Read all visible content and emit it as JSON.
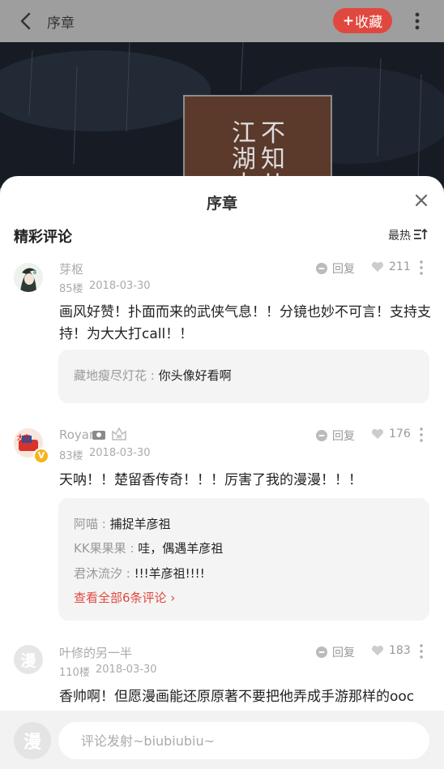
{
  "header": {
    "title": "序章",
    "favorite_label": "收藏",
    "favorite_plus": "+"
  },
  "cover": {
    "chars_col1": [
      "江",
      "湖",
      "中"
    ],
    "chars_col2": [
      "不",
      "知",
      "从"
    ]
  },
  "sheet": {
    "title": "序章",
    "section_title": "精彩评论",
    "sort_label": "最热"
  },
  "comments": [
    {
      "user": "芽枢",
      "floor": "85楼",
      "date": "2018-03-30",
      "reply_label": "回复",
      "likes": "211",
      "text": "画风好赞！扑面而来的武侠气息！！分镜也妙不可言！支持支持！为大大打call！！",
      "replies": [
        {
          "name": "藏地瘦尽灯花",
          "sep": " : ",
          "text": "你头像好看啊"
        }
      ]
    },
    {
      "user": "Royan",
      "floor": "83楼",
      "date": "2018-03-30",
      "reply_label": "回复",
      "likes": "176",
      "badge": "V",
      "text": "天呐！！楚留香传奇！！！厉害了我的漫漫！！！",
      "replies": [
        {
          "name": "阿喵",
          "sep": " : ",
          "text": "捕捉羊彦祖"
        },
        {
          "name": "KK果果果",
          "sep": " : ",
          "text": "哇，偶遇羊彦祖"
        },
        {
          "name": "君沐流汐",
          "sep": " : ",
          "text": "!!!羊彦祖!!!!"
        }
      ],
      "view_all": "查看全部6条评论 ›"
    },
    {
      "user": "叶修的另一半",
      "floor": "110楼",
      "date": "2018-03-30",
      "reply_label": "回复",
      "likes": "183",
      "avatar_char": "漫",
      "text": "香帅啊！但愿漫画能还原原著不要把他弄成手游那样的ooc"
    }
  ],
  "bottom": {
    "avatar_char": "漫",
    "placeholder": "评论发射~biubiubiu~"
  },
  "colors": {
    "accent": "#e0483f",
    "badge": "#f6b31b"
  }
}
